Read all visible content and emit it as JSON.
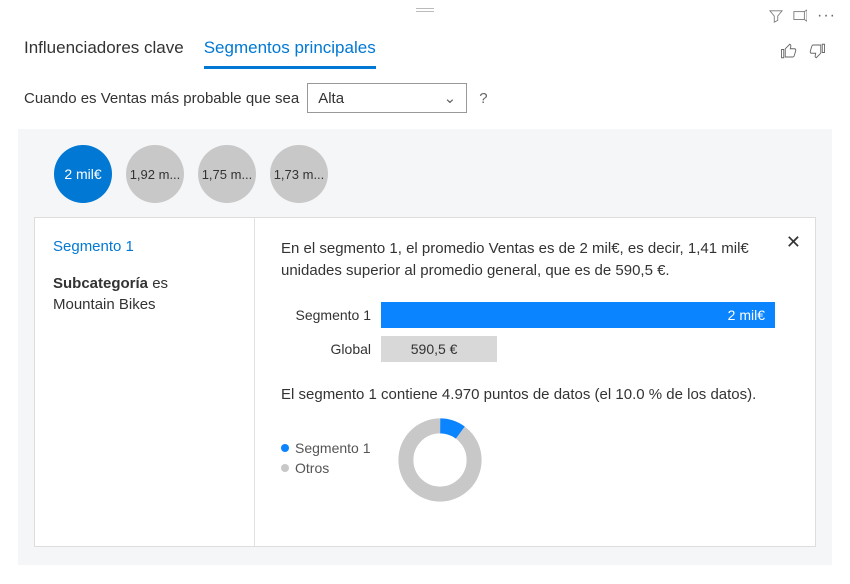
{
  "tabs": {
    "influencers": "Influenciadores clave",
    "segments": "Segmentos principales"
  },
  "query": {
    "prefix": "Cuando es Ventas más probable que sea",
    "dropdown_value": "Alta",
    "help": "?"
  },
  "bubbles": [
    "2 mil€",
    "1,92 m...",
    "1,75 m...",
    "1,73 m..."
  ],
  "segment": {
    "title": "Segmento 1",
    "condition_field": "Subcategoría",
    "condition_verb": "es",
    "condition_value": "Mountain Bikes"
  },
  "detail": {
    "summary": "En el segmento 1, el promedio Ventas es de 2 mil€, es decir, 1,41 mil€ unidades superior al promedio general, que es de 590,5 €.",
    "bar1_label": "Segmento 1",
    "bar1_value": "2 mil€",
    "bar2_label": "Global",
    "bar2_value": "590,5 €",
    "points_text": "El segmento 1 contiene 4.970 puntos de datos (el 10.0 % de los datos).",
    "legend1": "Segmento 1",
    "legend2": "Otros"
  },
  "chart_data": [
    {
      "type": "bar",
      "title": "Promedio Ventas",
      "categories": [
        "Segmento 1",
        "Global"
      ],
      "values": [
        2000,
        590.5
      ],
      "unit": "€"
    },
    {
      "type": "pie",
      "title": "Distribución de puntos de datos",
      "series": [
        {
          "name": "Segmento 1",
          "value": 10.0
        },
        {
          "name": "Otros",
          "value": 90.0
        }
      ],
      "unit": "%",
      "total_points": 4970
    }
  ]
}
